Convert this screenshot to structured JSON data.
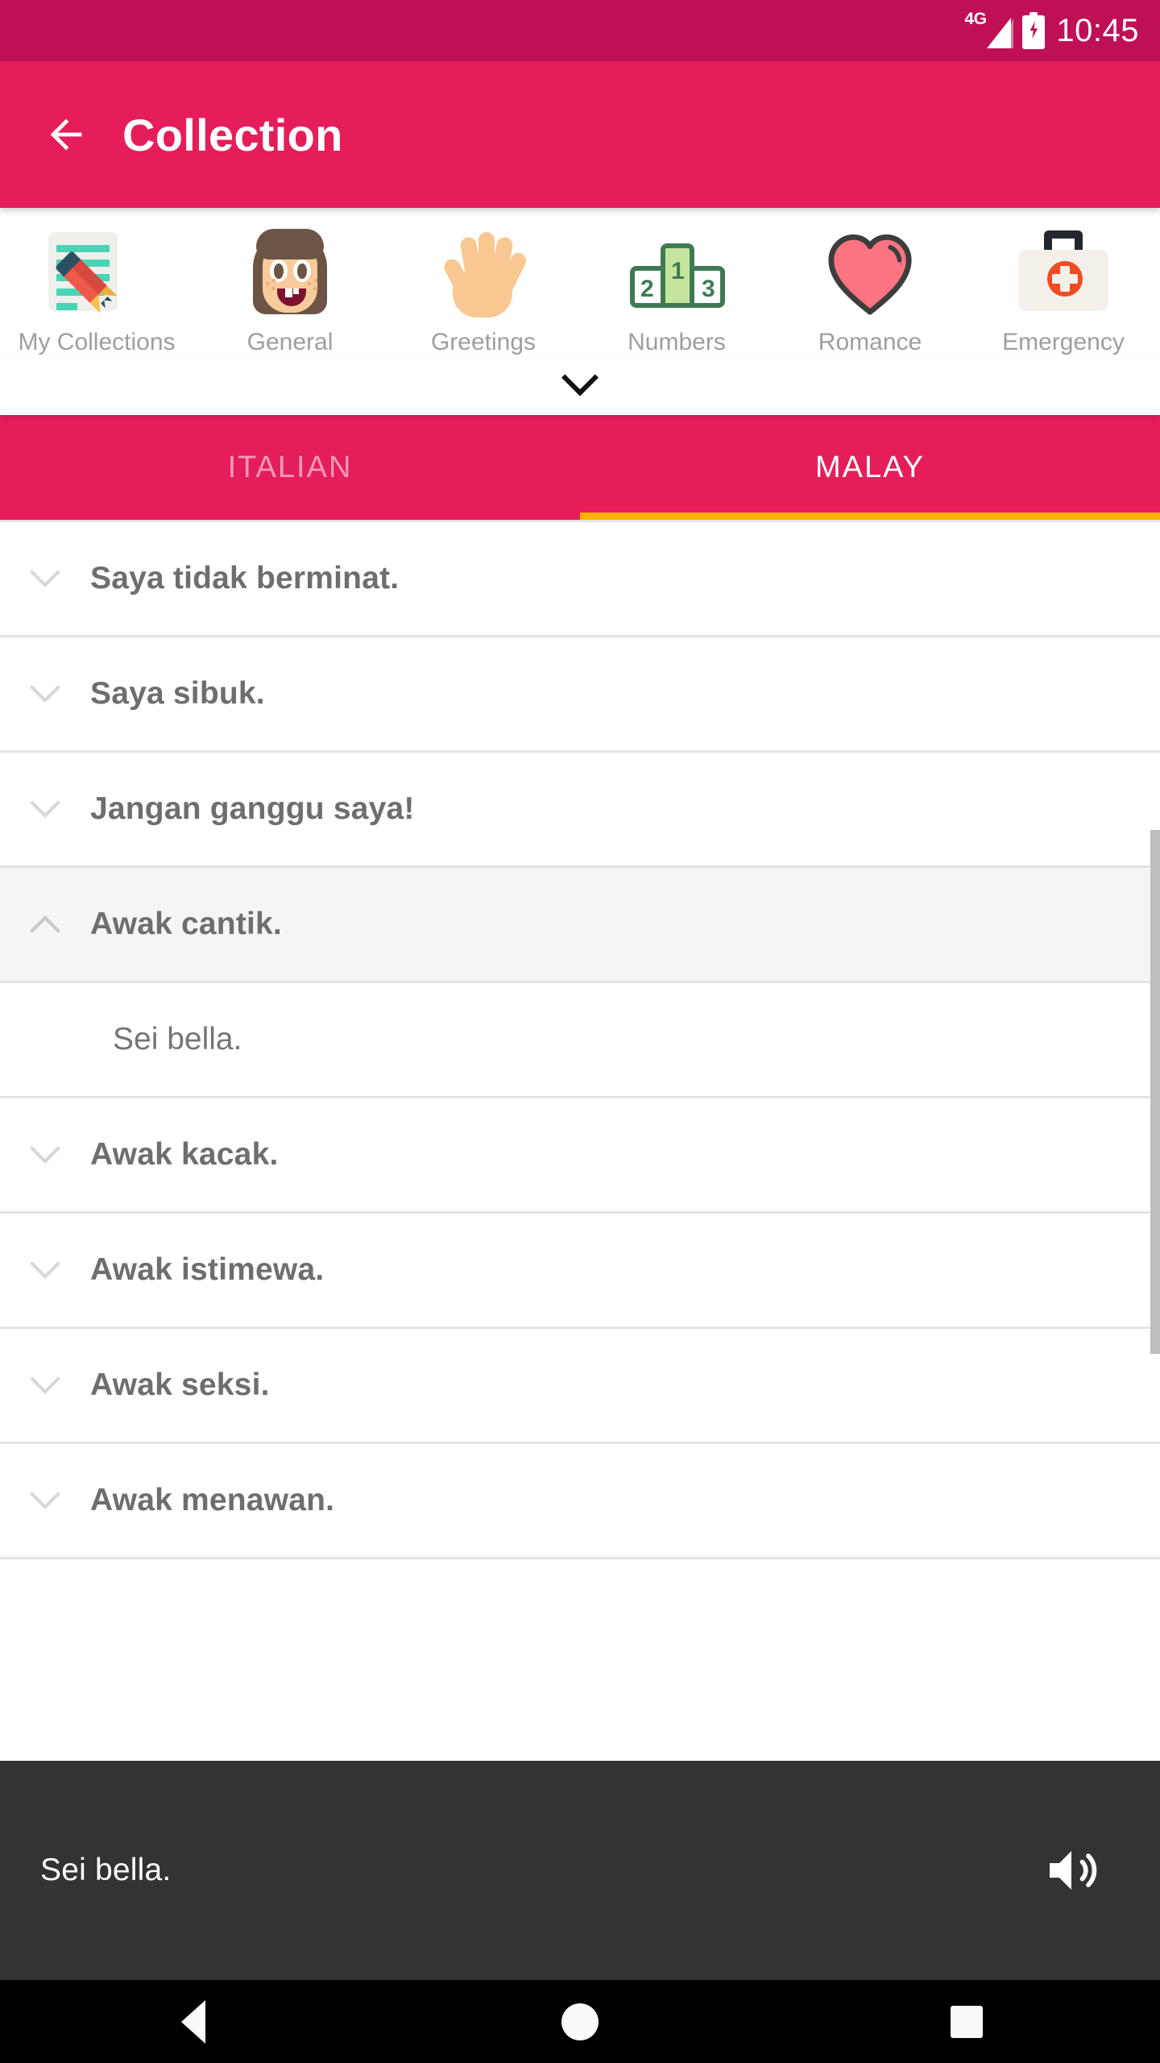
{
  "status_bar": {
    "network": "4G",
    "time": "10:45",
    "battery_icon": "battery-charging-icon",
    "signal_icon": "signal-bars-icon"
  },
  "app_bar": {
    "back_icon": "back-arrow-icon",
    "title": "Collection",
    "background": "#e51e5a"
  },
  "categories": {
    "expand_icon": "chevron-down-icon",
    "items": [
      {
        "label": "My Collections",
        "icon": "notepad-pencil-icon",
        "selected": false
      },
      {
        "label": "General",
        "icon": "girl-face-icon",
        "selected": false
      },
      {
        "label": "Greetings",
        "icon": "open-hand-icon",
        "selected": false
      },
      {
        "label": "Numbers",
        "icon": "podium-ranking-icon",
        "selected": false
      },
      {
        "label": "Romance",
        "icon": "heart-icon",
        "selected": false
      },
      {
        "label": "Emergency",
        "icon": "first-aid-kit-icon",
        "selected": false
      }
    ]
  },
  "podium": {
    "second": "2",
    "first": "1",
    "third": "3"
  },
  "tabs": {
    "indicator_color": "#ffb300",
    "items": [
      {
        "label": "ITALIAN",
        "active": false
      },
      {
        "label": "MALAY",
        "active": true
      }
    ]
  },
  "phrase_list": [
    {
      "text": "Saya tidak berminat.",
      "expanded": false,
      "chevron": "chevron-down-icon"
    },
    {
      "text": "Saya sibuk.",
      "expanded": false,
      "chevron": "chevron-down-icon"
    },
    {
      "text": "Jangan ganggu saya!",
      "expanded": false,
      "chevron": "chevron-down-icon"
    },
    {
      "text": "Awak cantik.",
      "expanded": true,
      "chevron": "chevron-up-icon",
      "translation": "Sei bella."
    },
    {
      "text": "Awak kacak.",
      "expanded": false,
      "chevron": "chevron-down-icon"
    },
    {
      "text": "Awak istimewa.",
      "expanded": false,
      "chevron": "chevron-down-icon"
    },
    {
      "text": "Awak seksi.",
      "expanded": false,
      "chevron": "chevron-down-icon"
    },
    {
      "text": "Awak menawan.",
      "expanded": false,
      "chevron": "chevron-down-icon"
    }
  ],
  "audio_bar": {
    "text": "Sei bella.",
    "speaker_icon": "volume-speaker-icon",
    "background": "#333333"
  },
  "nav_bar": {
    "back_icon": "nav-back-triangle-icon",
    "home_icon": "nav-home-circle-icon",
    "recents_icon": "nav-recents-square-icon"
  }
}
